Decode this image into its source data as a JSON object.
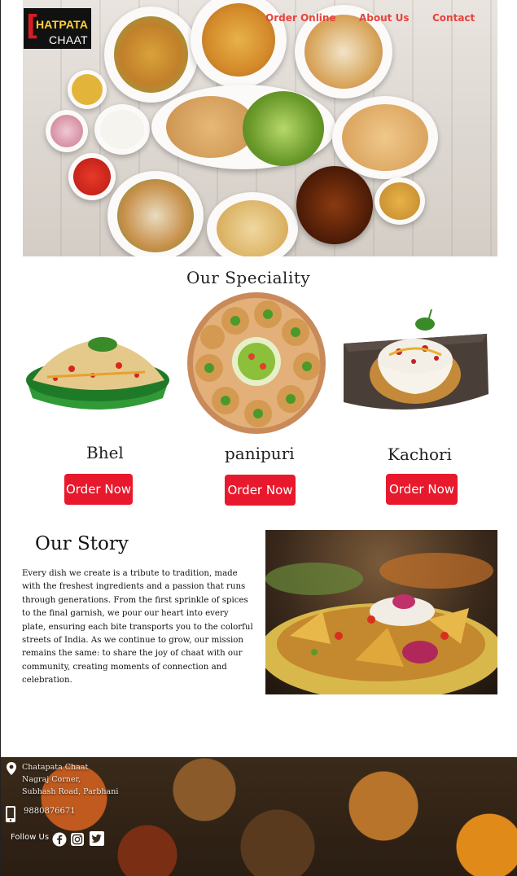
{
  "brand": {
    "logo_line1": "HATPATA",
    "logo_line2": "CHAAT"
  },
  "nav": {
    "order_online": "Order Online",
    "about_us": "About Us",
    "contact": "Contact"
  },
  "speciality": {
    "title": "Our  Speciality",
    "dishes": [
      {
        "name": "Bhel",
        "button": "Order Now"
      },
      {
        "name": "panipuri",
        "button": "Order Now"
      },
      {
        "name": "Kachori",
        "button": "Order Now"
      }
    ]
  },
  "story": {
    "title": "Our Story",
    "text": "Every dish we create is a tribute to tradition, made with the freshest ingredients and a passion that runs through generations. From the first sprinkle of spices to the final garnish, we pour our heart into every plate, ensuring each bite transports you to the colorful streets of India. As we continue to grow, our mission remains the same: to share the joy of chaat with our community, creating moments of connection and celebration."
  },
  "footer": {
    "address_line1": "Chatapata Chaat",
    "address_line2": "Nagraj Corner,",
    "address_line3": "Subhash Road, Parbhani",
    "phone": "9880876671",
    "follow_label": "Follow Us"
  },
  "colors": {
    "accent": "#e8192c",
    "nav": "#e8423a",
    "logo_yellow": "#ffd23a"
  },
  "icons": [
    "location-pin-icon",
    "mobile-phone-icon",
    "facebook-icon",
    "instagram-icon",
    "twitter-icon"
  ]
}
